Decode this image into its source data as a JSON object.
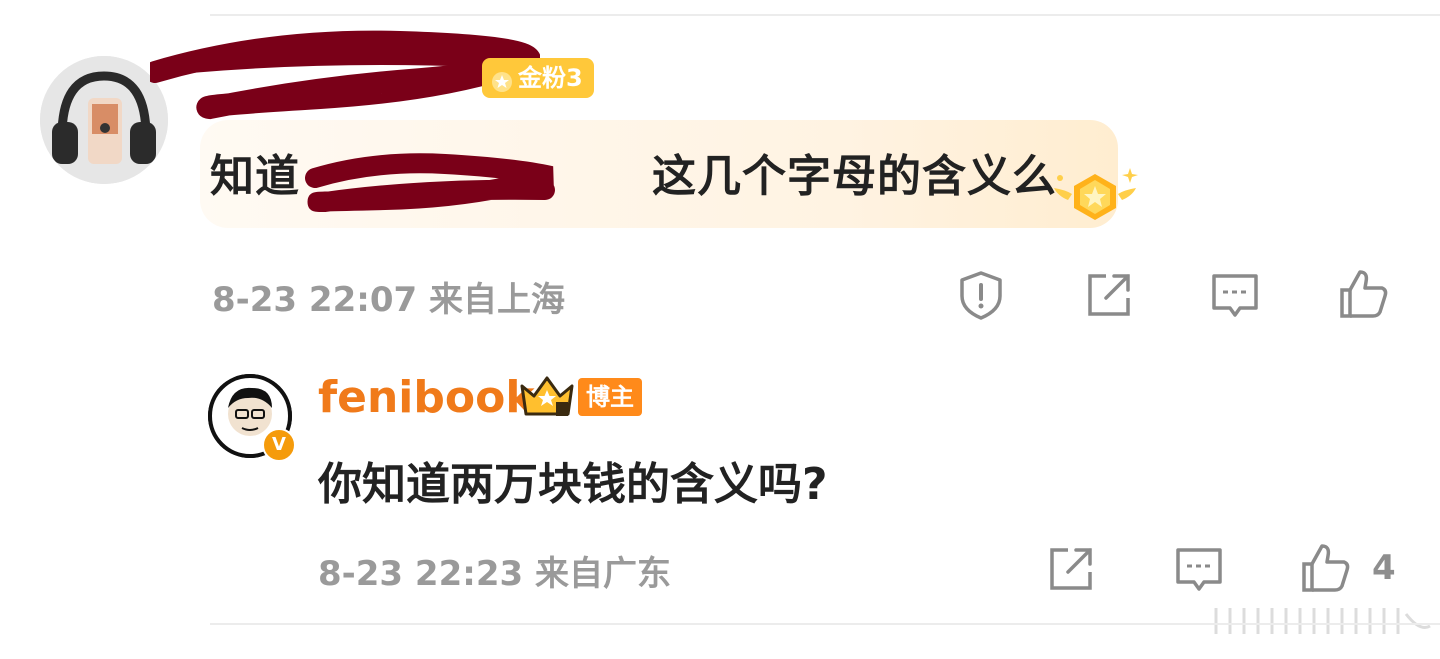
{
  "colors": {
    "accent_orange": "#f07a1a",
    "fan_badge": "#ffc83a",
    "host_badge": "#ff8a1a",
    "meta_gray": "#9a9a9a",
    "redaction": "#7a0018"
  },
  "comment": {
    "fan_badge_label": "金粉3",
    "text_start": "知道",
    "text_end": "这几个字母的含义么",
    "timestamp": "8-23 22:07",
    "location": "来自上海",
    "actions": [
      "report-icon",
      "share-icon",
      "comment-icon",
      "like-icon"
    ]
  },
  "reply": {
    "username": "fenibook",
    "host_badge_label": "博主",
    "verified_mark": "V",
    "text": "你知道两万块钱的含义吗?",
    "timestamp": "8-23 22:23",
    "location": "来自广东",
    "like_count": "4",
    "actions": [
      "share-icon",
      "comment-icon",
      "like-icon"
    ]
  }
}
